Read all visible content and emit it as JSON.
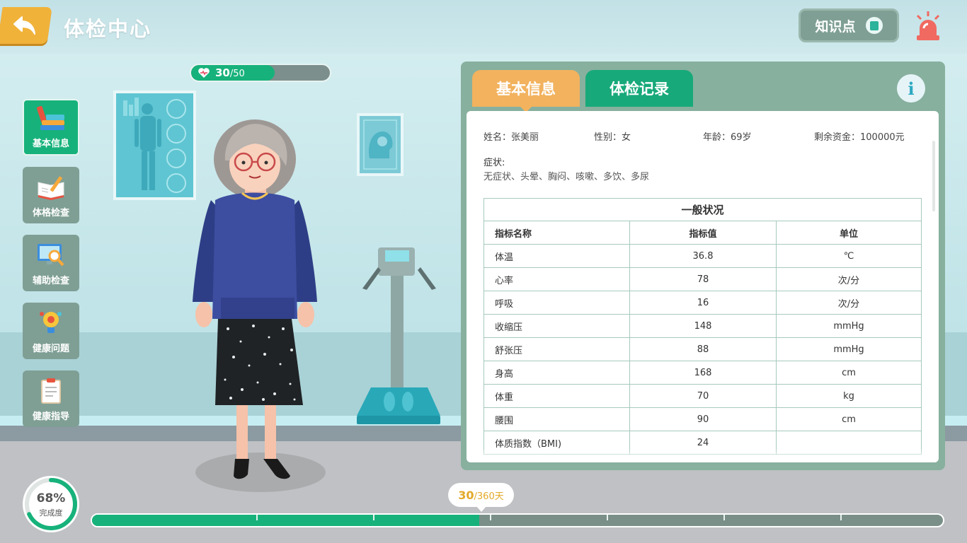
{
  "header": {
    "title": "体检中心",
    "knowledge_label": "知识点"
  },
  "hp": {
    "current": "30",
    "max": "/50",
    "fraction": 0.6
  },
  "menu": [
    {
      "label": "基本信息",
      "icon": "books-icon",
      "active": true
    },
    {
      "label": "体格检查",
      "icon": "notebook-icon",
      "active": false
    },
    {
      "label": "辅助检查",
      "icon": "monitor-magnifier-icon",
      "active": false
    },
    {
      "label": "健康问题",
      "icon": "lightbulb-icon",
      "active": false
    },
    {
      "label": "健康指导",
      "icon": "clipboard-icon",
      "active": false
    }
  ],
  "panel": {
    "tabs": [
      "基本信息",
      "体检记录"
    ],
    "active_tab": 0,
    "info_icon": "i",
    "patient": {
      "name": "姓名：张美丽",
      "gender": "性别：女",
      "age": "年龄：69岁",
      "funds": "剩余资金：100000元"
    },
    "symptom_title": "症状:",
    "symptoms": "无症状、头晕、胸闷、咳嗽、多饮、多尿",
    "table": {
      "caption": "一般状况",
      "headers": [
        "指标名称",
        "指标值",
        "单位"
      ],
      "rows": [
        [
          "体温",
          "36.8",
          "℃"
        ],
        [
          "心率",
          "78",
          "次/分"
        ],
        [
          "呼吸",
          "16",
          "次/分"
        ],
        [
          "收缩压",
          "148",
          "mmHg"
        ],
        [
          "舒张压",
          "88",
          "mmHg"
        ],
        [
          "身高",
          "168",
          "cm"
        ],
        [
          "体重",
          "70",
          "kg"
        ],
        [
          "腰围",
          "90",
          "cm"
        ],
        [
          "体质指数（BMI)",
          "24",
          ""
        ]
      ]
    }
  },
  "completion": {
    "percent": "68%",
    "label": "完成度",
    "fraction": 0.68
  },
  "timeline": {
    "current": "30",
    "total": "/360天",
    "fraction": 0.455
  },
  "colors": {
    "primary_green": "#17b27b",
    "orange": "#f2b25e",
    "panel_green": "#87b09e",
    "gold": "#e3a92a"
  }
}
